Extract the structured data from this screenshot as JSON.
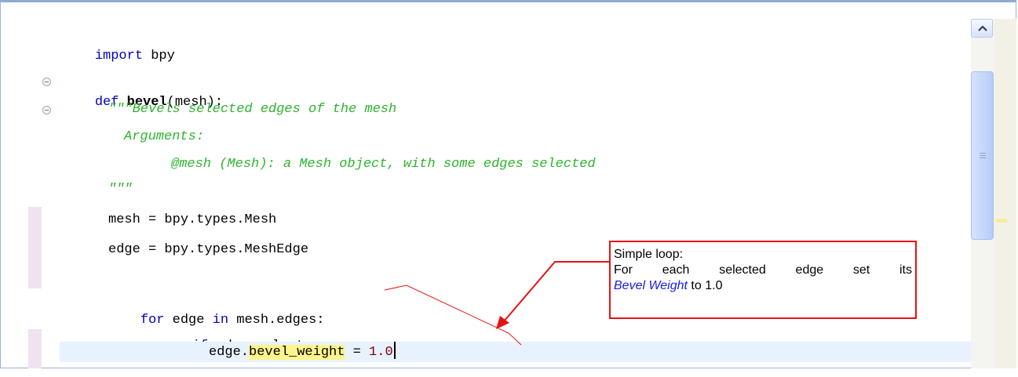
{
  "editor": {
    "lines": {
      "import": {
        "kw": "import",
        "rest": " bpy"
      },
      "def": {
        "kw": "def",
        "name": "bevel",
        "params": "(mesh):"
      },
      "doc1": "\"\"\"Bevels selected edges of the mesh",
      "doc2": "Arguments:",
      "doc3": "@mesh (Mesh): a Mesh object, with some edges selected",
      "doc4": "\"\"\"",
      "mesh_assign": "mesh = bpy.types.Mesh",
      "edge_assign": "edge = bpy.types.MeshEdge",
      "for": {
        "kw1": "for",
        "mid": " edge ",
        "kw2": "in",
        "rest": " mesh.edges:"
      },
      "if": {
        "kw": "if",
        "rest": " edge.select:"
      },
      "assign": {
        "obj": "edge.",
        "attr": "bevel_weight",
        "op": " = ",
        "value": "1.0"
      }
    }
  },
  "callout": {
    "line1": "Simple loop:",
    "line2": "For each selected edge set its",
    "em": "Bevel Weight",
    "line3_rest": " to 1.0"
  },
  "colors": {
    "keyword": "#0000c0",
    "docstring": "#2db32d",
    "highlight": "#fdf48c",
    "callout_border": "#e81111",
    "current_line": "#e8f2fe"
  },
  "icons": {
    "fold": "fold-collapse-icon",
    "scroll_up": "chevron-up-icon"
  }
}
